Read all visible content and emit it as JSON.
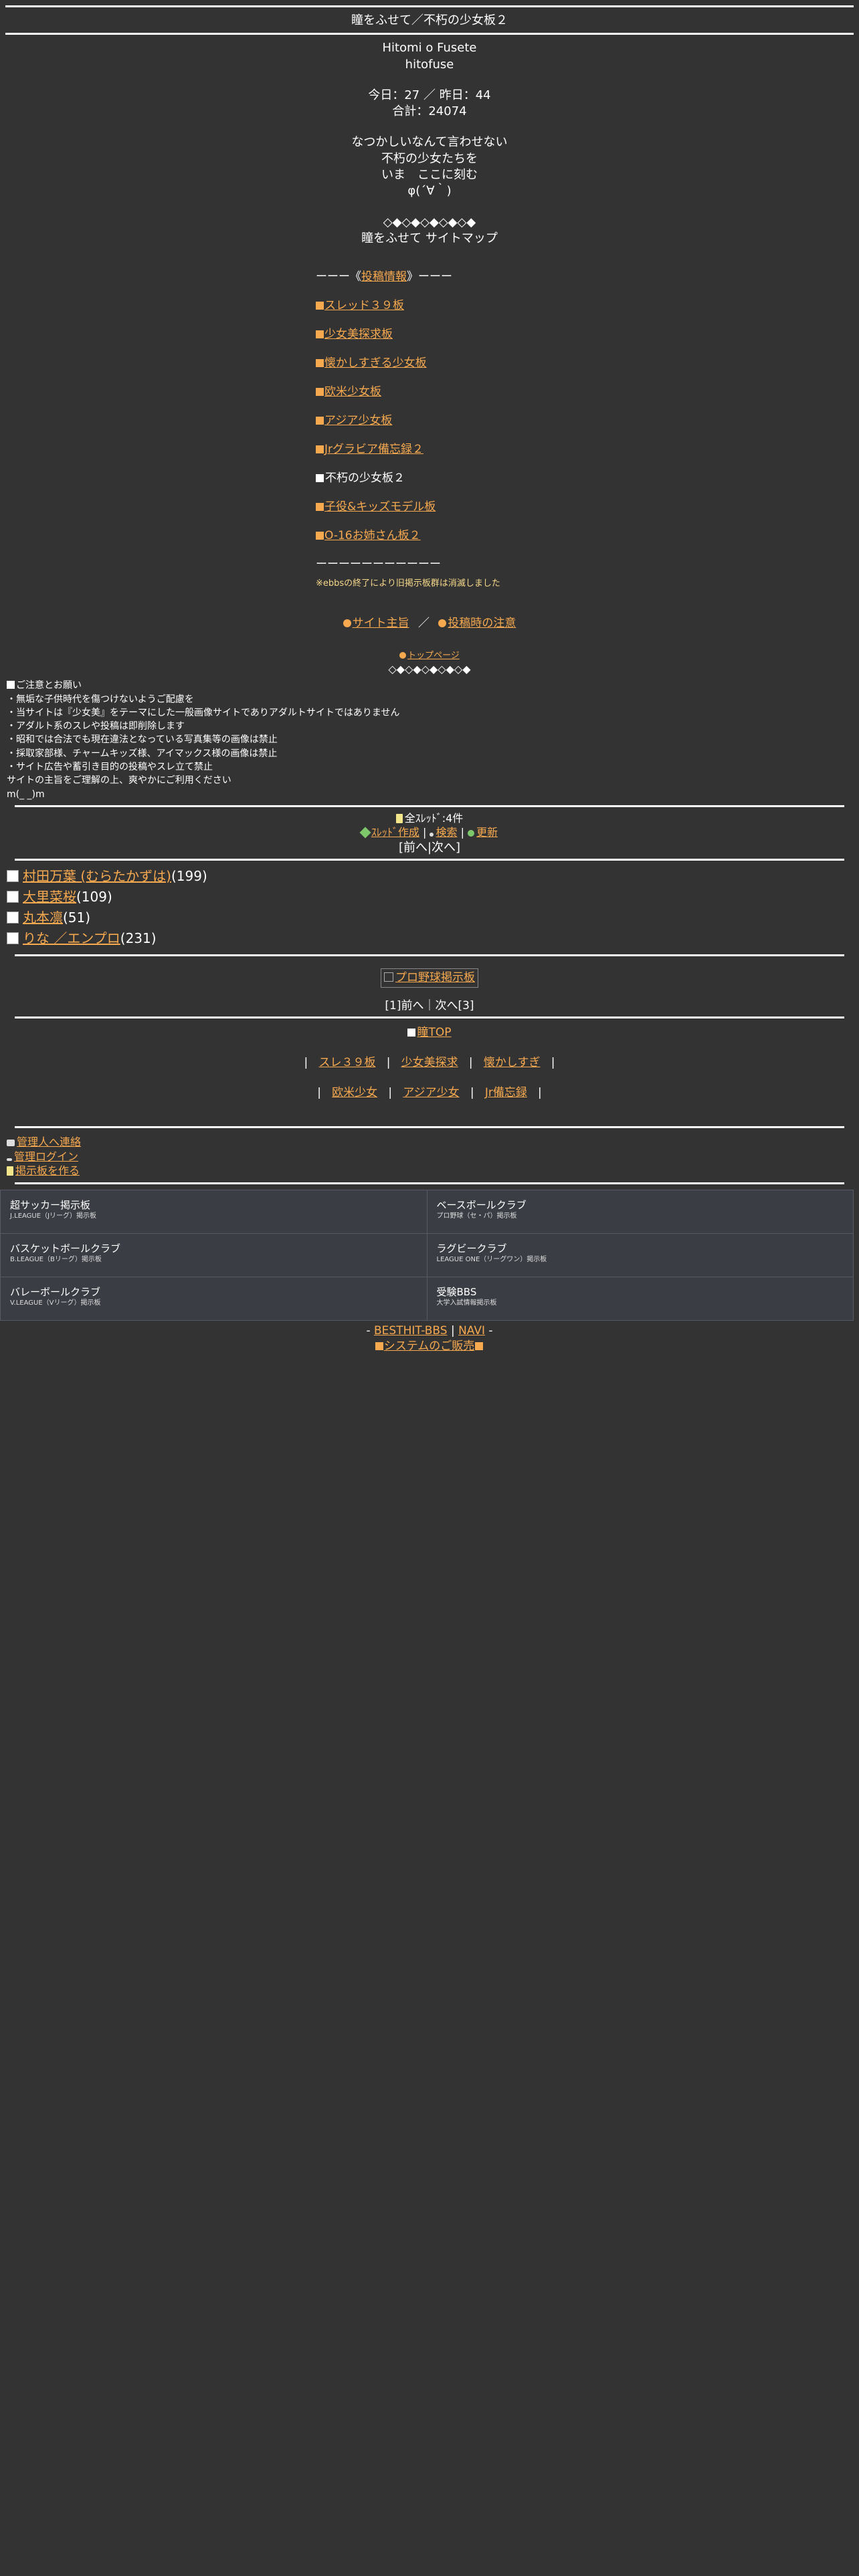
{
  "header": {
    "title": "瞳をふせて／不朽の少女板２"
  },
  "brand": {
    "name_en": "Hitomi o Fusete",
    "name_romaji": "hitofuse"
  },
  "counter": {
    "today": "今日：27 ／ 昨日：44",
    "total": "合計：24074"
  },
  "tagline": [
    "なつかしいなんて言わせない",
    "不朽の少女たちを",
    "いま　ここに刻む",
    "φ(´∀｀)"
  ],
  "sitemap": {
    "deco": "◇◆◇◆◇◆◇◆◇◆",
    "title": "瞳をふせて サイトマップ"
  },
  "nav": {
    "header_prefix": "ーーー《",
    "header_link": "投稿情報",
    "header_suffix": "》ーーー",
    "items": [
      {
        "label": "スレッド３９板",
        "link": true
      },
      {
        "label": "少女美探求板",
        "link": true
      },
      {
        "label": "懐かしすぎる少女板",
        "link": true
      },
      {
        "label": "欧米少女板",
        "link": true
      },
      {
        "label": "アジア少女板",
        "link": true
      },
      {
        "label": "Jrグラビア備忘録２",
        "link": true
      },
      {
        "label": "不朽の少女板２",
        "link": false
      },
      {
        "label": "子役&キッズモデル板",
        "link": true
      },
      {
        "label": "O-16お姉さん板２",
        "link": true
      }
    ],
    "separator": "ーーーーーーーーーーー",
    "note": "※ebbsの終了により旧掲示板群は消滅しました"
  },
  "links": {
    "site_main": "サイト主旨",
    "slash": "／",
    "post_notice": "投稿時の注意",
    "top_page": "トップページ"
  },
  "notice": {
    "title": "ご注意とお願い",
    "lines": [
      "・無垢な子供時代を傷つけないようご配慮を",
      "・当サイトは『少女美』をテーマにした一般画像サイトでありアダルトサイトではありません",
      "・アダルト系のスレや投稿は即削除します",
      "・昭和では合法でも現在違法となっている写真集等の画像は禁止",
      "・採取家部様、チャームキッズ様、アイマックス様の画像は禁止",
      "・サイト広告や蓄引き目的の投稿やスレ立て禁止",
      "サイトの主旨をご理解の上、爽やかにご利用ください",
      "m(_ _)m"
    ]
  },
  "thread_bar": {
    "all_threads": "全ｽﾚｯﾄﾞ:4件",
    "create": "ｽﾚｯﾄﾞ作成",
    "sep": "|",
    "search": "検索",
    "sep2": "|",
    "update": "更新",
    "pager": "[前へ|次へ]"
  },
  "threads": [
    {
      "title": "村田万葉 (むらたかずは)",
      "count": "(199)"
    },
    {
      "title": "大里菜桜",
      "count": "(109)"
    },
    {
      "title": "丸本凛",
      "count": "(51)"
    },
    {
      "title": "りな ／エンプロ",
      "count": "(231)"
    }
  ],
  "banner": {
    "alt": "プロ野球掲示板"
  },
  "pager_bottom": "[1]前へ｜次へ[3]",
  "bottom_nav": {
    "home": "瞳TOP",
    "row1": [
      "スレ３９板",
      "少女美探求",
      "懐かしすぎ"
    ],
    "row2": [
      "欧米少女",
      "アジア少女",
      "Jr備忘録"
    ]
  },
  "footer_links": {
    "contact": "管理人へ連絡",
    "login": "管理ログイン",
    "create_board": "掲示板を作る"
  },
  "sites": [
    {
      "name": "超サッカー掲示板",
      "sub": "J.LEAGUE（Jリーグ）掲示板"
    },
    {
      "name": "ベースボールクラブ",
      "sub": "プロ野球（セ・パ）掲示板"
    },
    {
      "name": "バスケットボールクラブ",
      "sub": "B.LEAGUE（Bリーグ）掲示板"
    },
    {
      "name": "ラグビークラブ",
      "sub": "LEAGUE ONE（リーグワン）掲示板"
    },
    {
      "name": "バレーボールクラブ",
      "sub": "V.LEAGUE（Vリーグ）掲示板"
    },
    {
      "name": "受験BBS",
      "sub": "大学入試情報掲示板"
    }
  ],
  "credit": {
    "pre": "- ",
    "besthit": "BESTHIT-BBS",
    "bar": " | ",
    "navi": "NAVI",
    "post": " -",
    "system": "システムのご販売"
  },
  "colors": {
    "background": "#333333",
    "link": "#f7a94f",
    "text": "#ffffff"
  }
}
